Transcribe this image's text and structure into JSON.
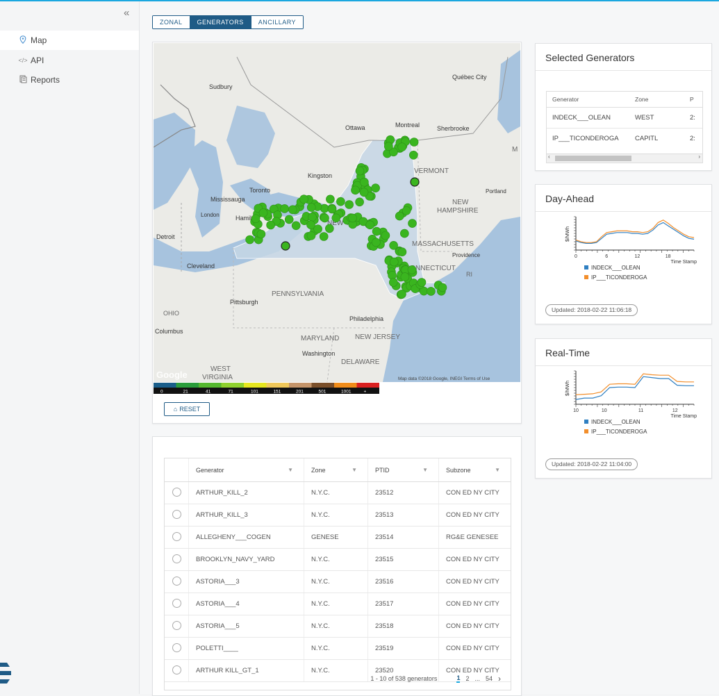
{
  "sidebar": {
    "collapse_icon": "double-chevron-left-icon",
    "items": [
      {
        "label": "Map",
        "icon": "map-pin-icon",
        "active": true
      },
      {
        "label": "API",
        "icon": "code-icon"
      },
      {
        "label": "Reports",
        "icon": "reports-icon"
      }
    ]
  },
  "tabs": [
    {
      "label": "ZONAL"
    },
    {
      "label": "GENERATORS",
      "active": true
    },
    {
      "label": "ANCILLARY"
    }
  ],
  "map": {
    "labels": {
      "sudbury": "Sudbury",
      "quebec": "Québec City",
      "ottawa": "Ottawa",
      "montreal": "Montreal",
      "sherbrooke": "Sherbrooke",
      "kingston": "Kingston",
      "toronto": "Toronto",
      "mississauga": "Mississauga",
      "london": "London",
      "hamilton": "Hamilton",
      "detroit": "Detroit",
      "cleveland": "Cleveland",
      "ohio": "OHIO",
      "columbus": "Columbus",
      "pittsburgh": "Pittsburgh",
      "pennsylvania": "PENNSYLVANIA",
      "newyork": "NEW YORK",
      "vermont": "VERMONT",
      "nh1": "NEW",
      "nh2": "HAMPSHIRE",
      "portland": "Portland",
      "massachusetts": "MASSACHUSETTS",
      "providence": "Providence",
      "connecticut": "CONNECTICUT",
      "ri": "RI",
      "philadelphia": "Philadelphia",
      "maryland": "MARYLAND",
      "newjersey": "NEW JERSEY",
      "washington": "Washington",
      "delaware": "DELAWARE",
      "wv1": "WEST",
      "wv2": "VIRGINIA",
      "maine": "M",
      "google": "Google",
      "attribution": "Map data ©2018 Google, INEGI   Terms of Use"
    },
    "legend": {
      "ticks": [
        "0",
        "21",
        "41",
        "71",
        "101",
        "151",
        "201",
        "501",
        "1001",
        "+"
      ],
      "colors": [
        "#1a5e8a",
        "#2a9d3b",
        "#55b82f",
        "#8fd12e",
        "#e6e61f",
        "#f0c85a",
        "#c4946a",
        "#7a4f2a",
        "#f08c1a",
        "#d92020"
      ]
    },
    "marker_color": "#3ab51f",
    "reset_label": "RESET"
  },
  "selected": {
    "title": "Selected Generators",
    "headers": [
      "Generator",
      "Zone",
      "P"
    ],
    "rows": [
      [
        "INDECK___OLEAN",
        "WEST",
        "2:"
      ],
      [
        "IP___TICONDEROGA",
        "CAPITL",
        "2:"
      ]
    ]
  },
  "day_ahead": {
    "title": "Day-Ahead",
    "ylabel": "$/MWh",
    "xlabel": "Time Stamp",
    "updated": "Updated: 2018-02-22 11:06:18"
  },
  "real_time": {
    "title": "Real-Time",
    "ylabel": "$/MWh",
    "xlabel": "Time Stamp",
    "updated": "Updated: 2018-02-22 11:04:00"
  },
  "chart_data": [
    {
      "type": "line",
      "title": "Day-Ahead",
      "xlabel": "Time Stamp",
      "ylabel": "$/MWh",
      "x": [
        0,
        1,
        2,
        3,
        4,
        5,
        6,
        7,
        8,
        9,
        10,
        11,
        12,
        13,
        14,
        15,
        16,
        17,
        18,
        19,
        20,
        21,
        22,
        23
      ],
      "xticks": [
        "0",
        "6",
        "12",
        "18"
      ],
      "ylim": [
        20,
        60
      ],
      "series": [
        {
          "name": "INDECK___OLEAN",
          "color": "#2f7fc1",
          "values": [
            31,
            29,
            28,
            28,
            29,
            34,
            39,
            40,
            41,
            41,
            41,
            40,
            40,
            39,
            40,
            44,
            50,
            53,
            49,
            45,
            41,
            37,
            34,
            33
          ]
        },
        {
          "name": "IP___TICONDEROGA",
          "color": "#f28e2b",
          "values": [
            32,
            30,
            29,
            29,
            30,
            36,
            41,
            42,
            43,
            43,
            43,
            42,
            42,
            41,
            42,
            46,
            53,
            56,
            52,
            47,
            43,
            39,
            36,
            35
          ]
        }
      ]
    },
    {
      "type": "line",
      "title": "Real-Time",
      "xlabel": "Time Stamp",
      "ylabel": "$/MWh",
      "x": [
        0,
        1,
        2,
        3,
        4,
        5,
        6,
        7,
        8,
        9,
        10,
        11,
        12,
        13,
        14
      ],
      "xticks": [
        "10",
        "10",
        "11",
        "12"
      ],
      "ylim": [
        21,
        28
      ],
      "series": [
        {
          "name": "INDECK___OLEAN",
          "color": "#2f7fc1",
          "values": [
            22,
            22.3,
            22.3,
            22.8,
            24.5,
            24.6,
            24.6,
            24.5,
            26.8,
            26.6,
            26.4,
            26.4,
            25,
            24.9,
            24.9
          ]
        },
        {
          "name": "IP___TICONDEROGA",
          "color": "#f28e2b",
          "values": [
            23,
            23.1,
            23.2,
            23.6,
            25.2,
            25.3,
            25.3,
            25.2,
            27.4,
            27.2,
            27.1,
            27.1,
            25.8,
            25.7,
            25.7
          ]
        }
      ]
    }
  ],
  "generators": {
    "headers": [
      "Generator",
      "Zone",
      "PTID",
      "Subzone"
    ],
    "rows": [
      [
        "ARTHUR_KILL_2",
        "N.Y.C.",
        "23512",
        "CON ED NY CITY"
      ],
      [
        "ARTHUR_KILL_3",
        "N.Y.C.",
        "23513",
        "CON ED NY CITY"
      ],
      [
        "ALLEGHENY___COGEN",
        "GENESE",
        "23514",
        "RG&E GENESEE"
      ],
      [
        "BROOKLYN_NAVY_YARD",
        "N.Y.C.",
        "23515",
        "CON ED NY CITY"
      ],
      [
        "ASTORIA___3",
        "N.Y.C.",
        "23516",
        "CON ED NY CITY"
      ],
      [
        "ASTORIA___4",
        "N.Y.C.",
        "23517",
        "CON ED NY CITY"
      ],
      [
        "ASTORIA___5",
        "N.Y.C.",
        "23518",
        "CON ED NY CITY"
      ],
      [
        "POLETTI____",
        "N.Y.C.",
        "23519",
        "CON ED NY CITY"
      ],
      [
        "ARTHUR KILL_GT_1",
        "N.Y.C.",
        "23520",
        "CON ED NY CITY"
      ]
    ],
    "summary": "1 - 10 of 538 generators",
    "pages": [
      "1",
      "2",
      "...",
      "54"
    ],
    "next": "›"
  }
}
